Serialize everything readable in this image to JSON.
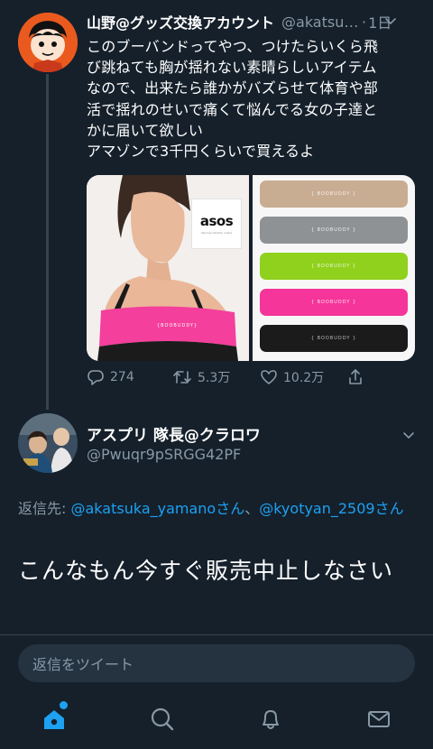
{
  "tweet": {
    "author_name": "山野@グッズ交換アカウント",
    "author_handle": "@akatsuka_yamano",
    "separator": "·",
    "time": "1日",
    "text_lines": [
      "このブーバンドってやつ、つけたらいくら飛",
      "び跳ねても胸が揺れない素晴らしいアイテム",
      "なので、出来たら誰かがバズらせて体育や部",
      "活で揺れのせいで痛くて悩んでる女の子達と",
      "かに届いて欲しい",
      "アマゾンで3千円くらいで買えるよ"
    ],
    "media": {
      "brand_logo": "asos",
      "brand_tagline": "discover fashion online",
      "band_label": "{ BOOBUDDY }",
      "band_colors": [
        "#c9ad93",
        "#8f9294",
        "#8fd11c",
        "#f5359a",
        "#1b1b1b"
      ]
    },
    "actions": {
      "reply_count": "274",
      "retweet_count": "5.3万",
      "like_count": "10.2万"
    }
  },
  "reply": {
    "author_name": "アスプリ 隊長@クラロワ",
    "author_handle": "@Pwuqr9pSRGG42PF",
    "reply_prefix": "返信先: ",
    "mention_1": "@akatsuka_yamanoさん",
    "mention_sep": "、",
    "mention_2": "@kyotyan_2509さん",
    "text": "こんなもん今すぐ販売中止しなさい"
  },
  "composer": {
    "placeholder": "返信をツイート"
  },
  "tabs": {
    "home": "home-icon",
    "search": "search-icon",
    "notifications": "bell-icon",
    "messages": "mail-icon"
  },
  "colors": {
    "background": "#15202b",
    "accent": "#1da1f2",
    "secondary_text": "#8899a6",
    "divider": "#38444d"
  }
}
